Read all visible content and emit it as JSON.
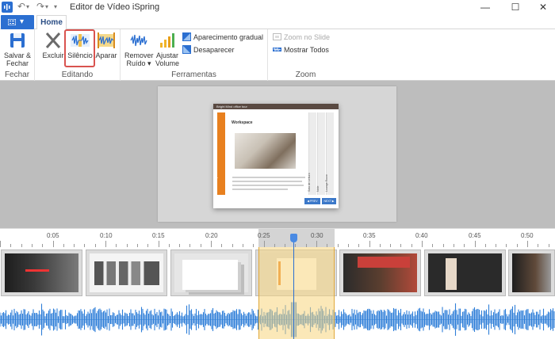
{
  "window": {
    "title": "Editor de Vídeo iSpring",
    "minimize_glyph": "—",
    "maximize_glyph": "☐",
    "close_glyph": "✕"
  },
  "quick_access": {
    "undo_glyph": "↶",
    "redo_glyph": "↷",
    "menu_glyph": "▾"
  },
  "tabs": {
    "file_menu_glyph": "▾",
    "home": "Home"
  },
  "ribbon": {
    "groups": {
      "fechar": "Fechar",
      "editando": "Editando",
      "ferramentas": "Ferramentas",
      "zoom": "Zoom"
    },
    "buttons": {
      "salvar_fechar_1": "Salvar &",
      "salvar_fechar_2": "Fechar",
      "excluir": "Excluir",
      "silencio": "Silêncio",
      "aparar": "Aparar",
      "remover_ruido_1": "Remover",
      "remover_ruido_2": "Ruído ▾",
      "ajustar_volume_1": "Ajustar",
      "ajustar_volume_2": "Volume",
      "aparecimento_gradual": "Aparecimento gradual",
      "desaparecer": "Desaparecer",
      "zoom_no_slide": "Zoom no Slide",
      "mostrar_todos": "Mostrar Todos"
    },
    "highlighted_button": "silencio",
    "accent_color": "#2b6fd1",
    "highlight_color": "#d9534f"
  },
  "preview": {
    "slide_header": "Bright Mind office tour",
    "slide_title": "Workspace",
    "side_label": "Workspace",
    "tab_labels": [
      "Sala de Leitura",
      "Note",
      "Lounge Room"
    ],
    "prev_button": "◀ PREV",
    "next_button": "NEXT ▶"
  },
  "timeline": {
    "tick_labels": [
      "0:05",
      "0:10",
      "0:15",
      "0:20",
      "0:25",
      "0:30",
      "0:35",
      "0:40",
      "0:45",
      "0:50"
    ],
    "selection_start": "0:25",
    "selection_end": "0:32",
    "playhead_time": "0:28",
    "selection_color": "#f7d67e",
    "waveform_color": "#2f7fd8"
  }
}
